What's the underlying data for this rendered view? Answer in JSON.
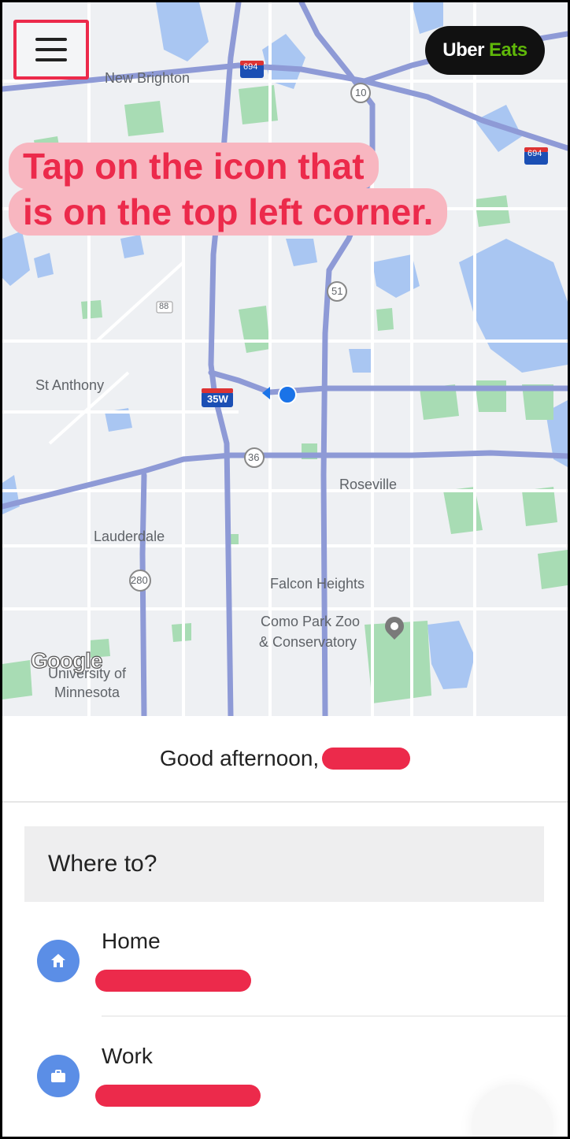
{
  "map": {
    "labels": {
      "new_brighton": "New Brighton",
      "st_anthony": "St Anthony",
      "roseville": "Roseville",
      "lauderdale": "Lauderdale",
      "falcon_heights": "Falcon Heights",
      "como_zoo_1": "Como Park Zoo",
      "como_zoo_2": "& Conservatory",
      "univ_1": "University of",
      "univ_2": "Minnesota",
      "google": "Google"
    },
    "shields": {
      "i694_a": "694",
      "us10": "10",
      "i694_b": "694",
      "r10_top": "10",
      "r51": "51",
      "r88": "88",
      "r35w": "35W",
      "r36": "36",
      "r280": "280"
    }
  },
  "header": {
    "menu_icon": "hamburger-menu-icon",
    "brand_uber": "Uber",
    "brand_eats": "Eats"
  },
  "tip": {
    "line1": "Tap on the icon that",
    "line2": "is on the top left corner."
  },
  "sheet": {
    "greeting": "Good afternoon,",
    "search_placeholder": "Where to?",
    "places": [
      {
        "name": "Home",
        "icon": "home-icon"
      },
      {
        "name": "Work",
        "icon": "briefcase-icon"
      }
    ]
  },
  "colors": {
    "highlight": "#ec2a4b",
    "tip_bg": "#f8b6c0",
    "eats_green": "#5fb709",
    "place_icon": "#5b8ee6",
    "road": "#8e9ad6"
  }
}
